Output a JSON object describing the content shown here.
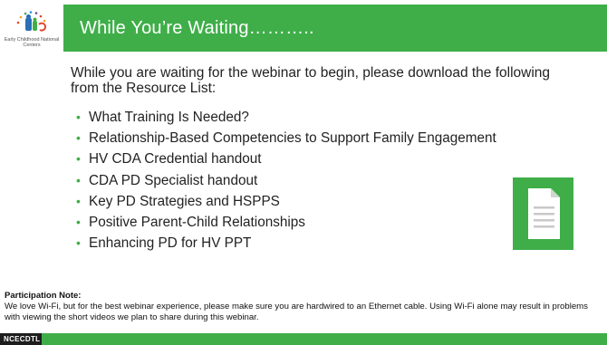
{
  "header": {
    "title": "While You’re Waiting………..",
    "logo_caption": "Early Childhood National Centers"
  },
  "intro": "While you are waiting for the webinar to begin, please download the following from the Resource List:",
  "bullets": [
    "What Training Is Needed?",
    "Relationship-Based Competencies to Support Family  Engagement",
    "HV CDA Credential handout",
    "CDA PD Specialist handout",
    "Key PD Strategies and HSPPS",
    "Positive Parent-Child Relationships",
    "Enhancing PD for HV PPT"
  ],
  "note": {
    "title": "Participation Note:",
    "text": "We love Wi-Fi, but for the best webinar experience, please make sure you are hardwired to an Ethernet cable. Using Wi-Fi alone may result in problems with viewing the short videos we plan to share during this webinar."
  },
  "footer": {
    "label": "NCECDTL"
  },
  "colors": {
    "accent": "#3fae49",
    "footer_dark": "#1d1d1d"
  },
  "icons": {
    "logo": "early-childhood-logo-icon",
    "document": "document-icon"
  }
}
